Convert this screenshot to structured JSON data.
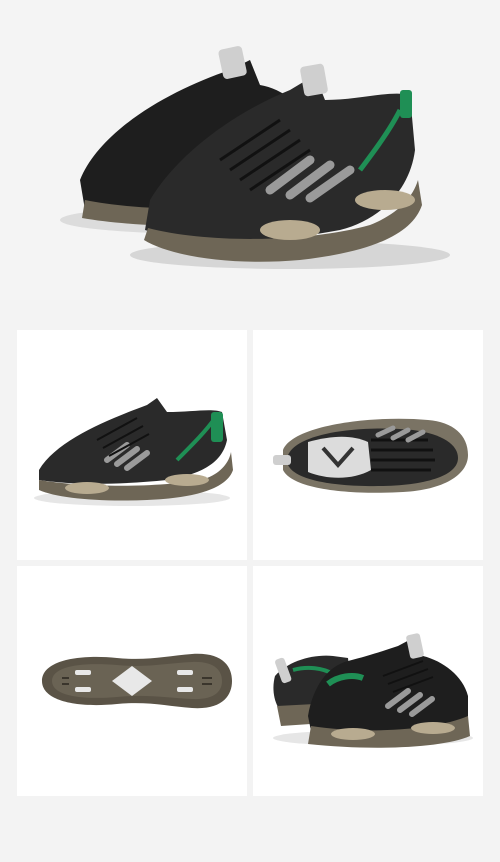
{
  "colors": {
    "background": "#f3f3f3",
    "tile": "#ffffff",
    "upper": "#2a2a2a",
    "upper_dark": "#1a1a1a",
    "accent": "#1f8f55",
    "silver": "#9a9a9a",
    "sole": "#6e6656",
    "sole_dark": "#4a4438"
  },
  "images": [
    {
      "name": "hero-pair-view",
      "icon": "sneaker-pair-icon"
    },
    {
      "name": "side-view",
      "icon": "sneaker-side-icon"
    },
    {
      "name": "top-view",
      "icon": "sneaker-top-icon"
    },
    {
      "name": "sole-view",
      "icon": "sneaker-sole-icon"
    },
    {
      "name": "pair-back-view",
      "icon": "sneaker-pair-back-icon"
    }
  ]
}
